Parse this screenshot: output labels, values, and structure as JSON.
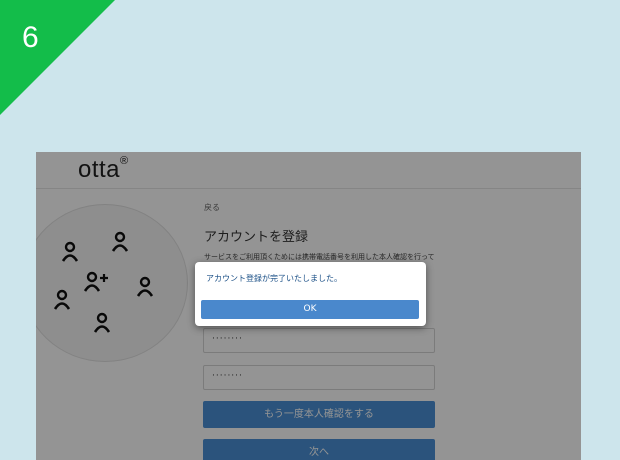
{
  "step": {
    "number": "6",
    "color": "#13bd4a"
  },
  "header": {
    "logo_text": "otta",
    "logo_mark": "®"
  },
  "illustration": {
    "icons": [
      "person-icon",
      "person-icon",
      "person-icon",
      "add-person-icon",
      "person-icon",
      "person-icon"
    ]
  },
  "form": {
    "back_label": "戻る",
    "title": "アカウントを登録",
    "description": "サービスをご利用頂くためには携帯電話番号を利用した本人確認を行って",
    "password_value": "········",
    "password_confirm_value": "········",
    "reverify_button_label": "もう一度本人確認をする",
    "next_button_label": "次へ"
  },
  "dialog": {
    "message": "アカウント登録が完了いたしました。",
    "ok_label": "OK"
  },
  "colors": {
    "background": "#cde5ec",
    "accent": "#4a90d6",
    "dialog_text": "#1a4f86"
  }
}
